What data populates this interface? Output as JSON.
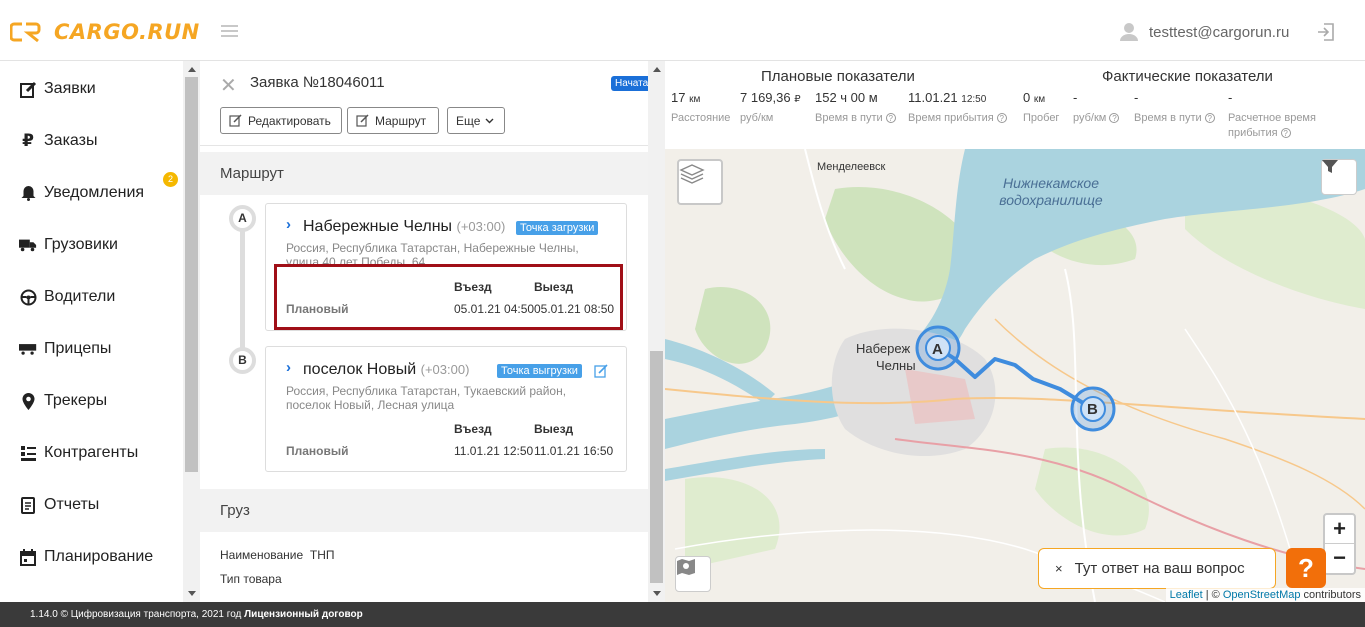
{
  "header": {
    "logo_text": "CARGO.RUN",
    "user_email": "testtest@cargorun.ru"
  },
  "sidebar": {
    "items": [
      {
        "label": "Заявки",
        "icon": "edit-icon"
      },
      {
        "label": "Заказы",
        "icon": "ruble-icon"
      },
      {
        "label": "Уведомления",
        "icon": "bell-icon",
        "badge": "2"
      },
      {
        "label": "Грузовики",
        "icon": "truck-icon"
      },
      {
        "label": "Водители",
        "icon": "steering-wheel-icon"
      },
      {
        "label": "Прицепы",
        "icon": "trailer-icon"
      },
      {
        "label": "Трекеры",
        "icon": "map-pin-icon"
      },
      {
        "label": "Контрагенты",
        "icon": "contacts-icon"
      },
      {
        "label": "Отчеты",
        "icon": "document-icon"
      },
      {
        "label": "Планирование",
        "icon": "calendar-icon"
      }
    ]
  },
  "order": {
    "title": "Заявка №18046011",
    "status": "Начата",
    "buttons": {
      "edit": "Редактировать",
      "route": "Маршрут",
      "more": "Еще"
    }
  },
  "route": {
    "section_title": "Маршрут",
    "col_in": "Въезд",
    "col_out": "Выезд",
    "row_label": "Плановый",
    "stops": [
      {
        "letter": "A",
        "name": "Набережные Челны",
        "tz": "(+03:00)",
        "type": "Точка загрузки",
        "address_line1": "Россия, Республика Татарстан, Набережные Челны,",
        "address_line2": "улица 40 лет Победы, 64",
        "plan_in": "05.01.21 04:50",
        "plan_out": "05.01.21 08:50"
      },
      {
        "letter": "B",
        "name": "поселок Новый",
        "tz": "(+03:00)",
        "type": "Точка выгрузки",
        "address_line1": "Россия, Республика Татарстан, Тукаевский район,",
        "address_line2": "поселок Новый, Лесная улица",
        "plan_in": "11.01.21 12:50",
        "plan_out": "11.01.21 16:50"
      }
    ]
  },
  "cargo": {
    "section_title": "Груз",
    "name_label": "Наименование",
    "name_value": "ТНП",
    "type_label": "Тип товара"
  },
  "metrics": {
    "planned_title": "Плановые показатели",
    "actual_title": "Фактические показатели",
    "planned": [
      {
        "value": "17",
        "unit": "км",
        "label": "Расстояние"
      },
      {
        "value": "7 169,36",
        "unit": "₽",
        "label": "руб/км"
      },
      {
        "value": "152 ч 00 м",
        "unit": "",
        "label": "Время в пути"
      },
      {
        "value": "11.01.21",
        "unit": "12:50",
        "label": "Время прибытия"
      }
    ],
    "actual": [
      {
        "value": "0",
        "unit": "км",
        "label": "Пробег"
      },
      {
        "value": "-",
        "unit": "",
        "label": "руб/км"
      },
      {
        "value": "-",
        "unit": "",
        "label": "Время в пути"
      },
      {
        "value": "-",
        "unit": "",
        "label_line1": "Расчетное время",
        "label_line2": "прибытия"
      }
    ]
  },
  "map": {
    "city_label_1": "Менделеевск",
    "city_label_2a": "Набереж",
    "city_label_2b": "Челны",
    "water_label_1": "Нижнекамское",
    "water_label_2": "водохранилище",
    "marker_a": "A",
    "marker_b": "B",
    "zoom_in": "+",
    "zoom_out": "−",
    "help_text": "Тут ответ на ваш вопрос",
    "help_close": "×",
    "help_button": "?",
    "attrib_leaflet": "Leaflet",
    "attrib_sep": " | © ",
    "attrib_osm": "OpenStreetMap",
    "attrib_tail": " contributors"
  },
  "footer": {
    "text": "1.14.0 © Цифровизация транспорта, 2021 год ",
    "license": "Лицензионный договор"
  },
  "colors": {
    "brand": "#f5a623",
    "accent_blue": "#1a6fd8",
    "highlight_red": "#a00f17",
    "help_orange": "#f26f0a"
  }
}
